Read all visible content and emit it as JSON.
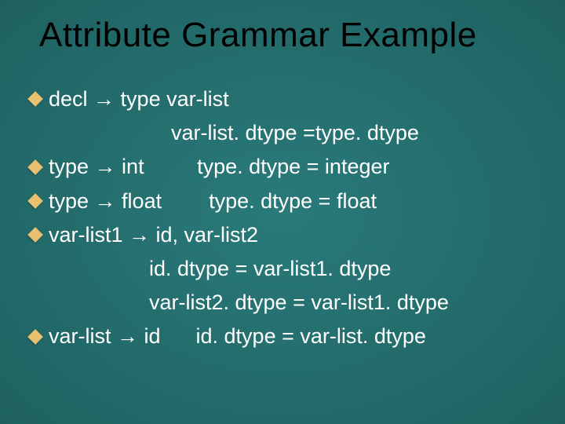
{
  "title": "Attribute Grammar Example",
  "lines": {
    "l1a": "decl ",
    "l1b": " type var-list",
    "l2": "var-list. dtype =type. dtype",
    "l3a": "type ",
    "l3b": " int         type. dtype = integer",
    "l4a": "type ",
    "l4b": " float        type. dtype = float",
    "l5a": "var-list1 ",
    "l5b": " id, var-list2",
    "l6": "id. dtype = var-list1. dtype",
    "l7": "var-list2. dtype = var-list1. dtype",
    "l8a": "var-list ",
    "l8b": " id      id. dtype = var-list. dtype"
  },
  "arrow": "→"
}
